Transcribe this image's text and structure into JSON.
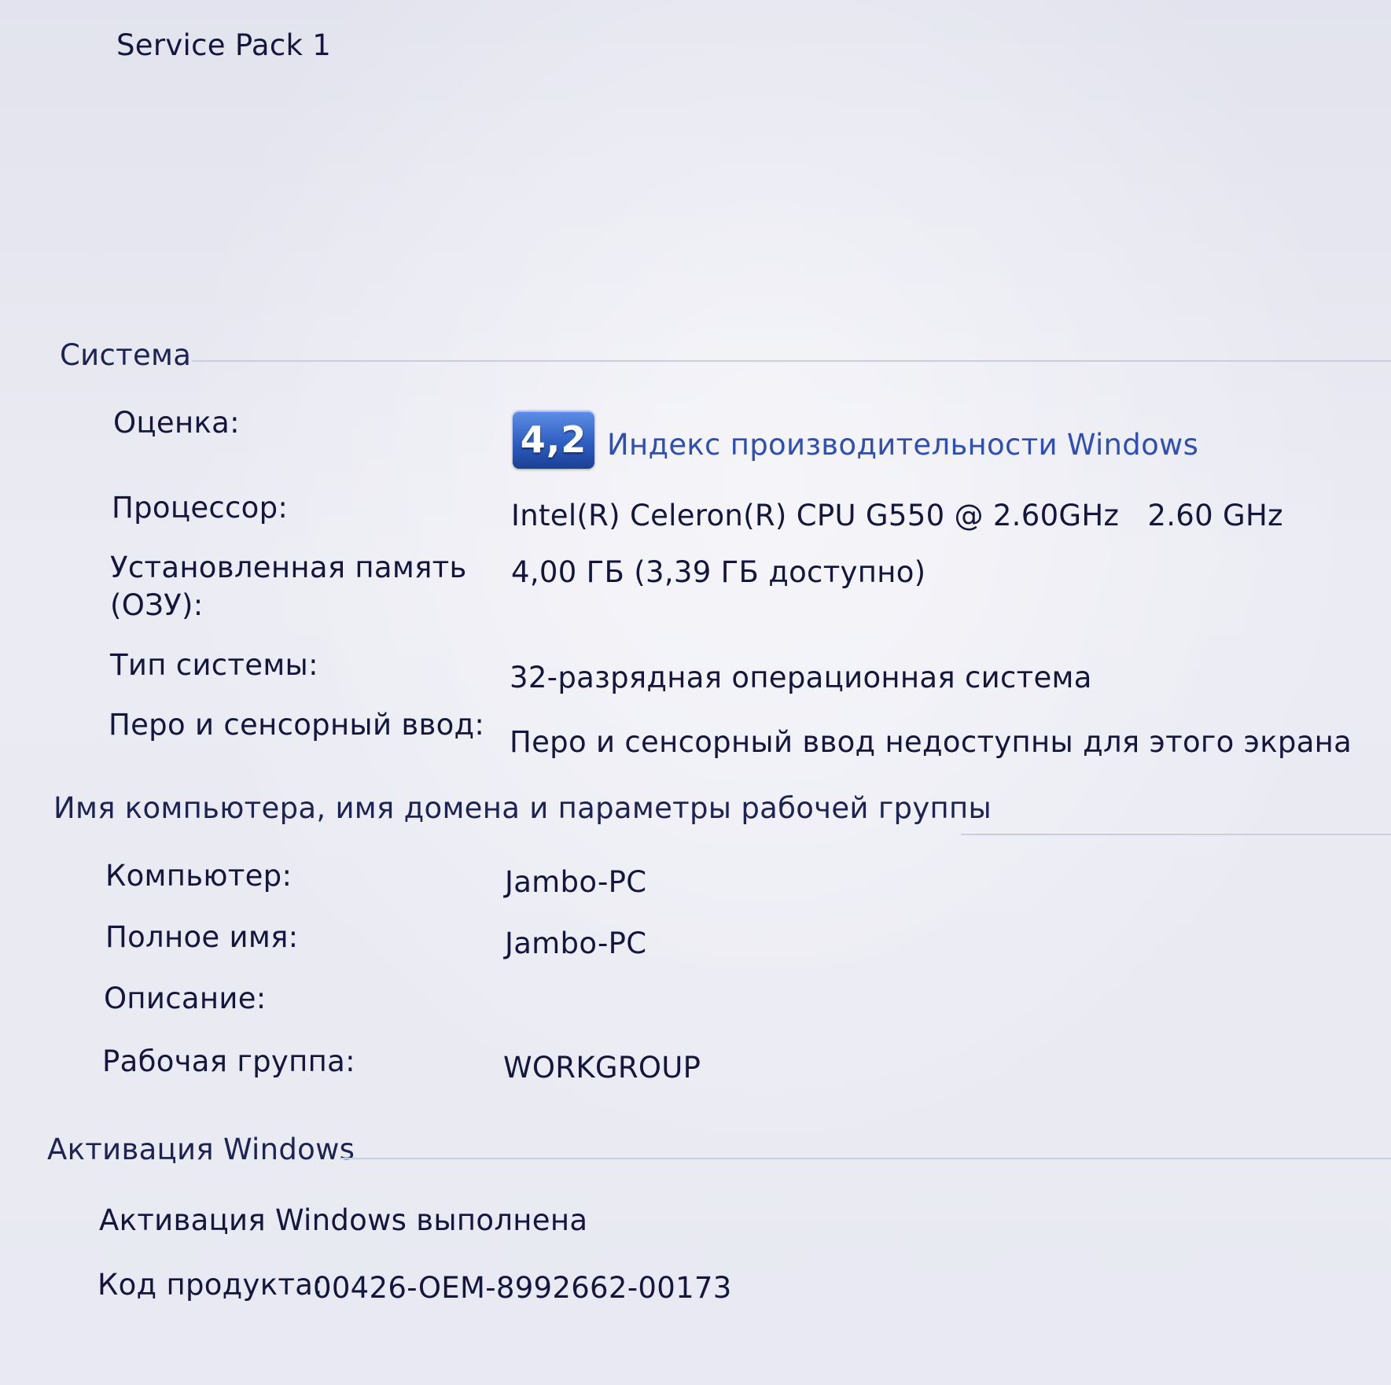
{
  "top": {
    "service_pack": "Service Pack 1"
  },
  "system": {
    "heading": "Система",
    "rating_label": "Оценка:",
    "rating_value": "4,2",
    "rating_link": "Индекс производительности Windows",
    "processor_label": "Процессор:",
    "processor_value": "Intel(R) Celeron(R) CPU G550 @ 2.60GHz   2.60 GHz",
    "memory_label_line1": "Установленная память",
    "memory_label_line2": "(ОЗУ):",
    "memory_value": "4,00 ГБ (3,39 ГБ доступно)",
    "system_type_label": "Тип системы:",
    "system_type_value": "32-разрядная операционная система",
    "pen_label": "Перо и сенсорный ввод:",
    "pen_value": "Перо и сенсорный ввод недоступны для этого экрана"
  },
  "computer": {
    "heading": "Имя компьютера, имя домена и параметры рабочей группы",
    "computer_label": "Компьютер:",
    "computer_value": "Jambo-PC",
    "full_name_label": "Полное имя:",
    "full_name_value": "Jambo-PC",
    "description_label": "Описание:",
    "description_value": "",
    "workgroup_label": "Рабочая группа:",
    "workgroup_value": "WORKGROUP"
  },
  "activation": {
    "heading": "Активация Windows",
    "status": "Активация Windows выполнена",
    "product_key_label": "Код продукта:",
    "product_key_value": "00426-OEM-8992662-00173"
  },
  "colors": {
    "background": "#e7e8f2",
    "text": "#14163d",
    "link": "#2f4fb3",
    "badge": "#2e5fc2"
  }
}
